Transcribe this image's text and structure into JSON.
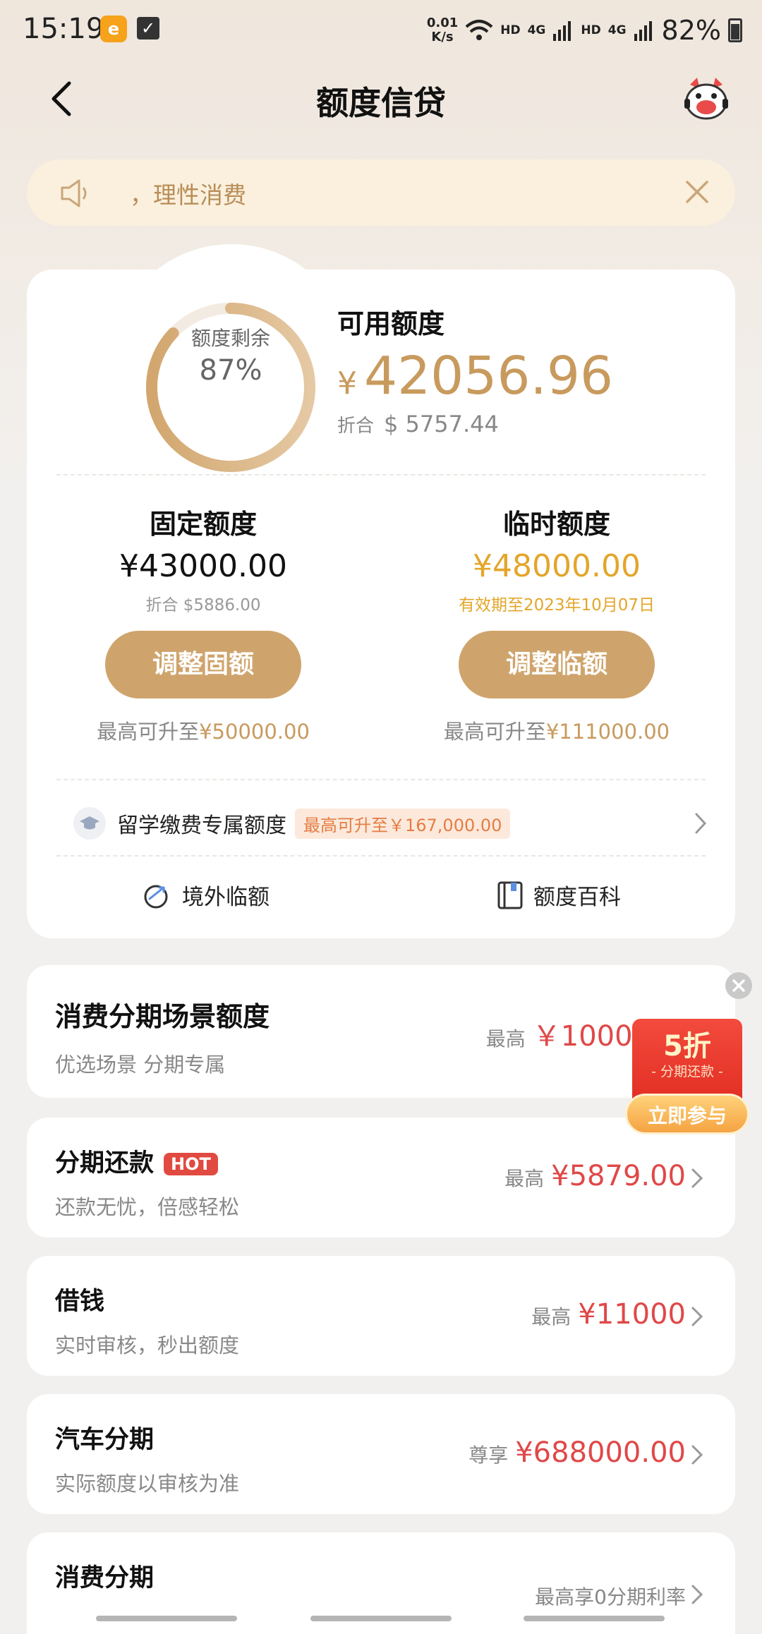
{
  "status_bar": {
    "time": "15:19",
    "net_speed_value": "0.01",
    "net_speed_unit": "K/s",
    "hd1": "HD",
    "net1": "4G",
    "hd2": "HD",
    "net2": "4G",
    "battery": "82%"
  },
  "header": {
    "title": "额度信贷"
  },
  "notice": {
    "text": "，理性消费"
  },
  "summary": {
    "ring_label": "额度剩余",
    "ring_value": "87%",
    "ring_fraction": 0.87,
    "available_title": "可用额度",
    "currency": "¥",
    "available_amount": "42056.96",
    "equiv_label": "折合",
    "equiv_value": "$ 5757.44"
  },
  "fixed_quota": {
    "title": "固定额度",
    "amount": "¥43000.00",
    "sub": "折合 $5886.00",
    "button": "调整固额",
    "raise_prefix": "最高可升至",
    "raise_amount": "¥50000.00"
  },
  "temp_quota": {
    "title": "临时额度",
    "amount": "¥48000.00",
    "sub": "有效期至2023年10月07日",
    "button": "调整临额",
    "raise_prefix": "最高可升至",
    "raise_amount": "¥111000.00"
  },
  "study": {
    "label": "留学缴费专属额度",
    "tag": "最高可升至￥167,000.00"
  },
  "tools": {
    "overseas": "境外临额",
    "encyclopedia": "额度百科"
  },
  "cards": [
    {
      "title": "消费分期场景额度",
      "sub": "优选场景 分期专属",
      "pre": "最高",
      "amount": "￥10000"
    },
    {
      "title": "分期还款",
      "badge": "HOT",
      "sub": "还款无忧，倍感轻松",
      "pre": "最高",
      "amount": "¥5879.00"
    },
    {
      "title": "借钱",
      "sub": "实时审核，秒出额度",
      "pre": "最高",
      "amount": "¥11000"
    },
    {
      "title": "汽车分期",
      "sub": "实际额度以审核为准",
      "pre": "尊享",
      "amount": "¥688000.00"
    },
    {
      "title": "消费分期",
      "pre": "最高享0分期利率"
    }
  ],
  "promo": {
    "discount": "5折",
    "label": "- 分期还款 -",
    "join": "立即参与"
  },
  "colors": {
    "gold": "#c89a5e",
    "accent_red": "#e04848",
    "button": "#cfa46c",
    "temp_gold": "#e3a62a"
  }
}
